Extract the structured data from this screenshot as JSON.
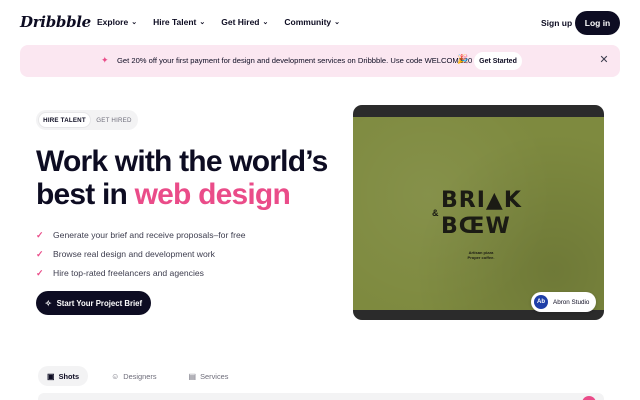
{
  "header": {
    "logo": "Dribbble",
    "nav": [
      {
        "label": "Explore",
        "icon": "chevron-down-icon"
      },
      {
        "label": "Hire Talent",
        "icon": "chevron-down-icon"
      },
      {
        "label": "Get Hired",
        "icon": "chevron-down-icon"
      },
      {
        "label": "Community",
        "icon": "chevron-down-icon"
      }
    ],
    "signup_label": "Sign up",
    "login_label": "Log in"
  },
  "banner": {
    "icon": "gift-icon",
    "text": "Get 20% off your first payment for design and development services on Dribbble. Use code WELCOME20",
    "party_icon": "party-popper-icon",
    "button_label": "Get Started",
    "close_icon": "close-icon"
  },
  "toggle": {
    "active": "HIRE TALENT",
    "inactive": "GET HIRED"
  },
  "hero": {
    "headline_line1": "Work with the world’s",
    "headline_prefix": "best in ",
    "headline_accent": "web design",
    "bullets": [
      "Generate your brief and receive proposals–for free",
      "Browse real design and development work",
      "Hire top-rated freelancers and agencies"
    ],
    "cta_label": "Start Your Project Brief",
    "image": {
      "brand_line1": "BRI▲K",
      "brand_line2": "BŒW",
      "brand_amp": "&",
      "brand_tag": "Artisan pizza Proper coffee.",
      "studio_avatar": "Ab",
      "studio_name": "Abron Studio"
    }
  },
  "tabs": [
    {
      "label": "Shots",
      "icon": "image-icon",
      "active": true
    },
    {
      "label": "Designers",
      "icon": "user-icon",
      "active": false
    },
    {
      "label": "Services",
      "icon": "document-icon",
      "active": false
    }
  ],
  "colors": {
    "accent": "#ea4c89",
    "ink": "#0d0c22",
    "banner_bg": "#fbe7f1",
    "hero_green": "#7e8a3f"
  }
}
